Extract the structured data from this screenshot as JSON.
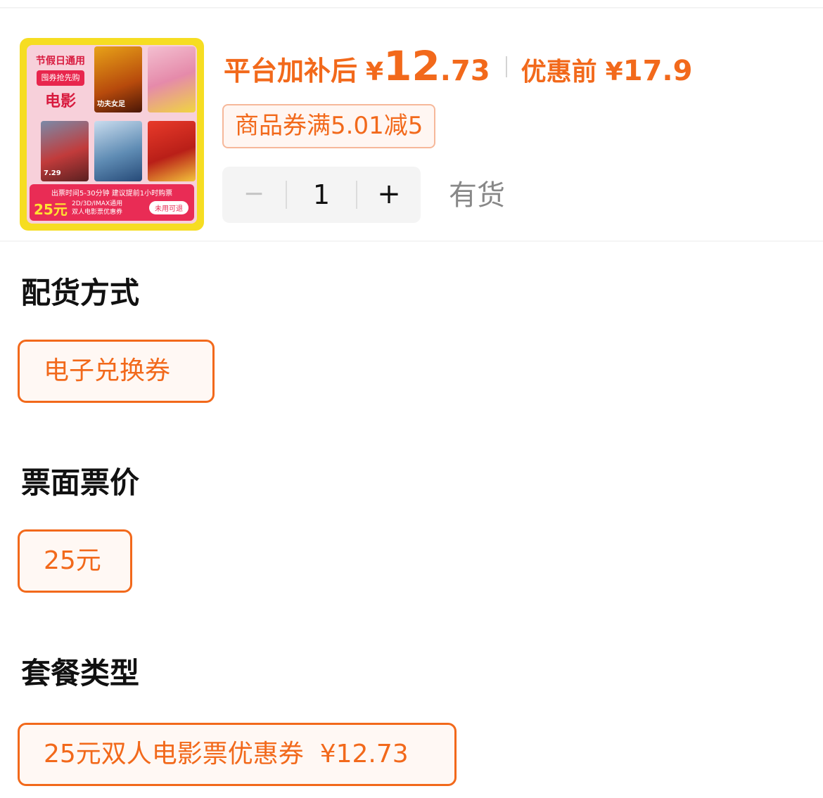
{
  "product": {
    "thumbnail": {
      "tag_line1": "节假日通用",
      "tag_line2": "囤券抢先购",
      "tag_line3": "电影",
      "poster_labels": [
        "",
        "功夫女足",
        "",
        "7.29",
        "",
        ""
      ],
      "banner_top": "出票时间5-30分钟 建议提前1小时购票",
      "banner_price": "25元",
      "banner_desc_line1": "2D/3D/IMAX通用",
      "banner_desc_line2": "双人电影票优惠券",
      "banner_button": "未用可退"
    },
    "price_label": "平台加补后",
    "currency": "¥",
    "price_int": "12",
    "price_dec": ".73",
    "orig_label": "优惠前",
    "orig_price": "17.9",
    "coupon": "商品券满5.01减5",
    "stepper": {
      "minus": "−",
      "value": "1",
      "plus": "+"
    },
    "stock": "有货"
  },
  "sections": {
    "delivery": {
      "title": "配货方式",
      "option": "电子兑换券"
    },
    "face_value": {
      "title": "票面票价",
      "option": "25元"
    },
    "package": {
      "title": "套餐类型",
      "option": "25元双人电影票优惠券  ¥12.73"
    }
  },
  "colors": {
    "accent": "#f2691b",
    "coupon_border": "#f6b89a",
    "stock_text": "#888888",
    "stepper_bg": "#f4f4f4"
  }
}
